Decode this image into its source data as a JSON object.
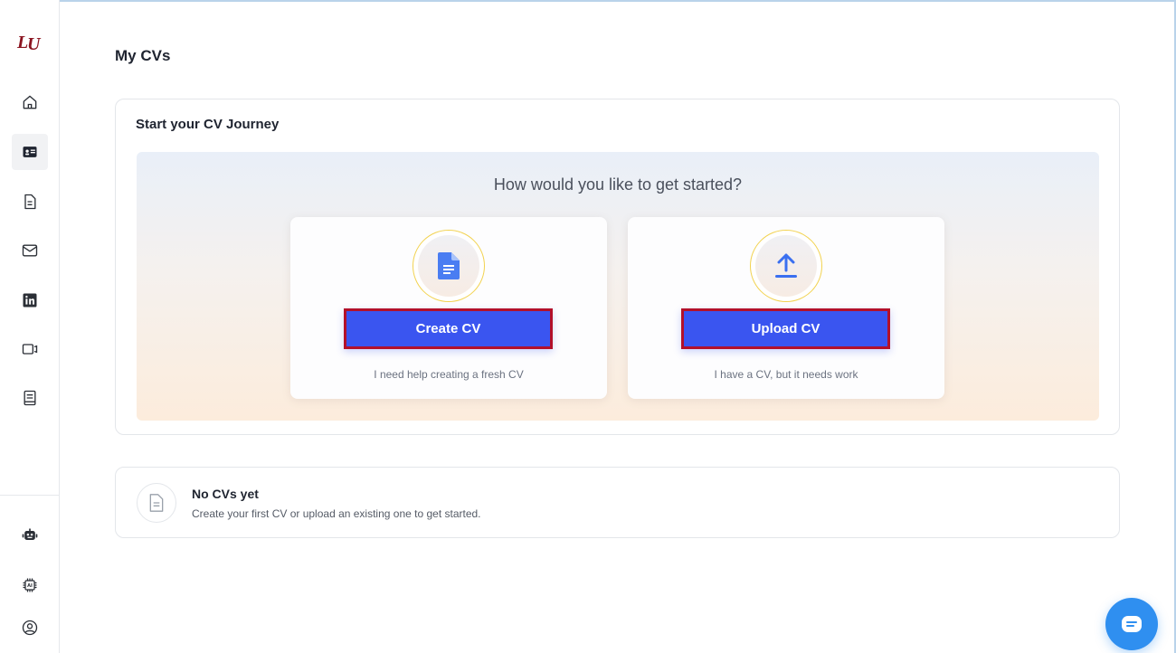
{
  "sidebar": {
    "logo_text": "LU",
    "items": [
      {
        "name": "home",
        "icon": "home-icon"
      },
      {
        "name": "my-cvs",
        "icon": "id-card-icon",
        "active": true
      },
      {
        "name": "documents",
        "icon": "document-icon"
      },
      {
        "name": "mail",
        "icon": "mail-icon"
      },
      {
        "name": "linkedin",
        "icon": "linkedin-icon"
      },
      {
        "name": "video",
        "icon": "video-icon"
      },
      {
        "name": "guide",
        "icon": "book-icon"
      },
      {
        "name": "bot",
        "icon": "robot-icon"
      },
      {
        "name": "ai",
        "icon": "ai-chip-icon"
      },
      {
        "name": "profile",
        "icon": "user-circle-icon"
      }
    ]
  },
  "page": {
    "title": "My CVs"
  },
  "journey": {
    "title": "Start your CV Journey",
    "heading": "How would you like to get started?",
    "options": [
      {
        "label": "Create CV",
        "caption": "I need help creating a fresh CV",
        "icon": "document-icon"
      },
      {
        "label": "Upload CV",
        "caption": "I have a CV, but it needs work",
        "icon": "upload-icon"
      }
    ]
  },
  "empty_state": {
    "title": "No CVs yet",
    "subtitle": "Create your first CV or upload an existing one to get started.",
    "icon": "file-icon"
  },
  "chat": {
    "icon": "chat-icon"
  },
  "colors": {
    "primary": "#3a55f0",
    "highlight_border": "#b3102a",
    "brand": "#8b1420",
    "chat": "#2f8ff0"
  }
}
